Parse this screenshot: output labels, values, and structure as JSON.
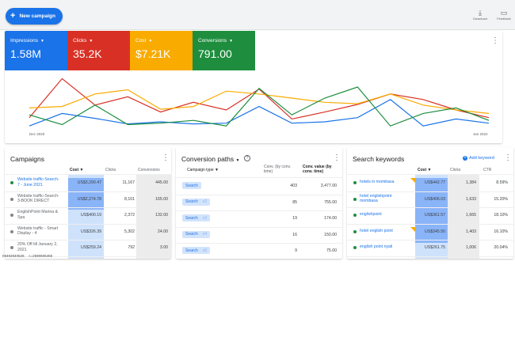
{
  "toolbar": {
    "new_campaign_label": "New campaign",
    "download_label": "Download",
    "feedback_label": "Feedback"
  },
  "metrics": [
    {
      "label": "Impressions",
      "value": "1.58M",
      "color": "#1a73e8"
    },
    {
      "label": "Clicks",
      "value": "35.2K",
      "color": "#d93025"
    },
    {
      "label": "Cost",
      "value": "$7.21K",
      "color": "#f9ab00"
    },
    {
      "label": "Conversions",
      "value": "791.00",
      "color": "#1e8e3e"
    }
  ],
  "chart_data": {
    "type": "line",
    "x_start_label": "Dec 2020",
    "x_end_label": "Jan 2022",
    "series": [
      {
        "metric": "Impressions",
        "color": "#1a73e8",
        "values": [
          2,
          20,
          13,
          5,
          8,
          5,
          6,
          30,
          6,
          8,
          14,
          40,
          2,
          12,
          6
        ]
      },
      {
        "metric": "Clicks",
        "color": "#d93025",
        "values": [
          14,
          70,
          32,
          44,
          22,
          36,
          25,
          55,
          12,
          22,
          33,
          48,
          40,
          25,
          14
        ]
      },
      {
        "metric": "Cost",
        "color": "#f9ab00",
        "values": [
          28,
          30,
          48,
          54,
          26,
          30,
          52,
          48,
          42,
          36,
          34,
          48,
          32,
          25,
          20
        ]
      },
      {
        "metric": "Conversions",
        "color": "#1e8e3e",
        "values": [
          18,
          4,
          32,
          4,
          6,
          10,
          2,
          56,
          18,
          42,
          58,
          2,
          20,
          28,
          10
        ]
      }
    ]
  },
  "campaigns": {
    "title": "Campaigns",
    "headers": [
      "Cost",
      "Clicks",
      "Conversions"
    ],
    "rows": [
      {
        "name_line1": "Website traffic-Search-",
        "name_line2": "7 - June 2021",
        "status": "green",
        "cost": "US$3,290.47",
        "clicks": "11,167",
        "conversions": "445.00"
      },
      {
        "name_line1": "Website traffic-Search-",
        "name_line2": "3-BOOK DIRECT",
        "status": "grey",
        "cost": "US$2,274.78",
        "clicks": "8,101",
        "conversions": "165.00"
      },
      {
        "name_line1": "EnglishPoint Marina &",
        "name_line2": "Spa",
        "status": "grey",
        "cost": "US$400.19",
        "clicks": "2,372",
        "conversions": "132.00"
      },
      {
        "name_line1": "Website traffic - Smart",
        "name_line2": "Display - 4",
        "status": "grey",
        "cost": "US$326.39",
        "clicks": "5,302",
        "conversions": "24.00"
      },
      {
        "name_line1": "20% Off till January 2,",
        "name_line2": "2021",
        "status": "grey",
        "cost": "US$259.24",
        "clicks": "792",
        "conversions": "3.00"
      }
    ],
    "footnote": "09492840528&#x2026; c=2590606455"
  },
  "conversion_paths": {
    "title": "Conversion paths",
    "filter_label": "Campaign type",
    "headers": [
      "Conv. (by conv. time)",
      "Conv. value (by conv. time)"
    ],
    "rows": [
      {
        "path": "Search",
        "multiplier": "",
        "conv": "403",
        "value": "3,477.00"
      },
      {
        "path": "Search",
        "multiplier": "x2",
        "conv": "85",
        "value": "755.00"
      },
      {
        "path": "Search",
        "multiplier": "x3",
        "conv": "19",
        "value": "174.00"
      },
      {
        "path": "Search",
        "multiplier": "x4",
        "conv": "16",
        "value": "150.00"
      },
      {
        "path": "Search",
        "multiplier": "x6",
        "conv": "9",
        "value": "75.00"
      }
    ]
  },
  "search_keywords": {
    "title": "Search keywords",
    "add_label": "Add keyword",
    "headers": [
      "Cost",
      "Clicks",
      "CTR"
    ],
    "rows": [
      {
        "kw_line1": "hotels in mombasa",
        "kw_line2": "",
        "cost": "US$442.77",
        "clicks": "1,384",
        "ctr": "8.59%"
      },
      {
        "kw_line1": "hotel englishpoint",
        "kw_line2": "mombasa",
        "cost": "US$406.03",
        "clicks": "1,633",
        "ctr": "15.20%"
      },
      {
        "kw_line1": "englishpoint",
        "kw_line2": "",
        "cost": "US$361.57",
        "clicks": "1,665",
        "ctr": "18.10%"
      },
      {
        "kw_line1": "hotel english point",
        "kw_line2": "",
        "cost": "US$345.50",
        "clicks": "1,403",
        "ctr": "16.10%"
      },
      {
        "kw_line1": "english point nyali",
        "kw_line2": "",
        "cost": "US$261.75",
        "clicks": "1,006",
        "ctr": "20.04%"
      }
    ]
  }
}
